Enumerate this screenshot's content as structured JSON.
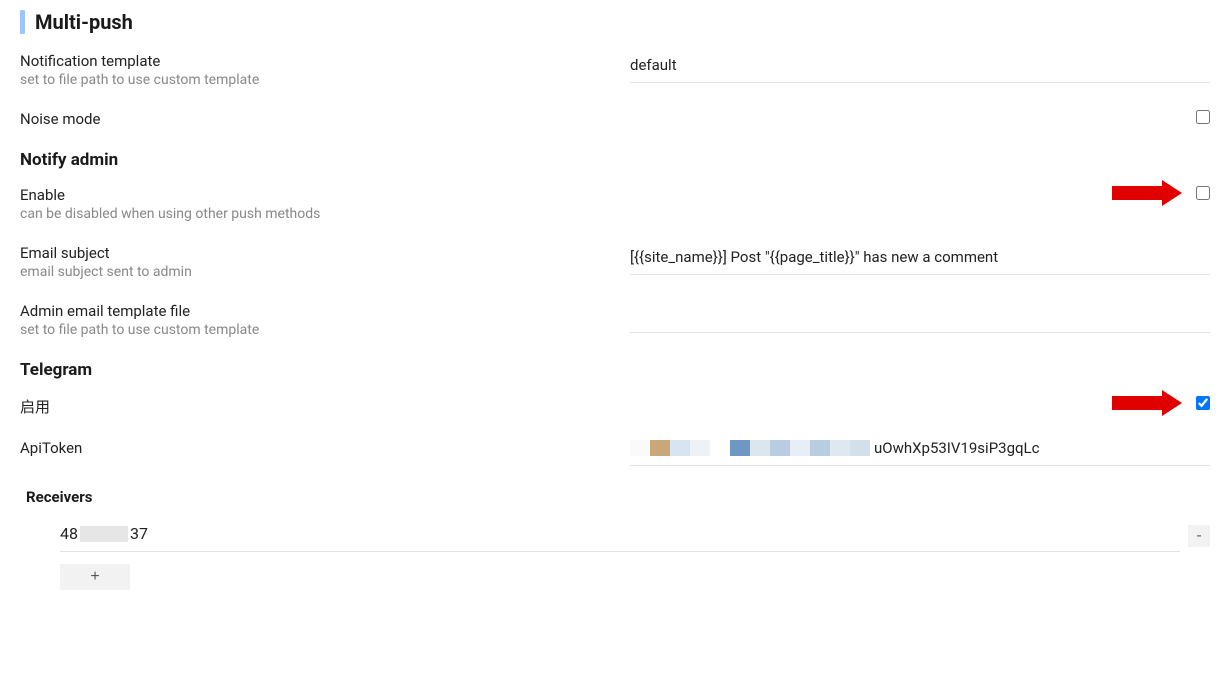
{
  "sections": {
    "multi_push": {
      "title": "Multi-push",
      "notification_template": {
        "label": "Notification template",
        "hint": "set to file path to use custom template",
        "value": "default"
      },
      "noise_mode": {
        "label": "Noise mode",
        "checked": false
      }
    },
    "notify_admin": {
      "title": "Notify admin",
      "enable": {
        "label": "Enable",
        "hint": "can be disabled when using other push methods",
        "checked": false
      },
      "email_subject": {
        "label": "Email subject",
        "hint": "email subject sent to admin",
        "value": "[{{site_name}}] Post \"{{page_title}}\" has new a comment"
      },
      "admin_email_template": {
        "label": "Admin email template file",
        "hint": "set to file path to use custom template",
        "value": ""
      }
    },
    "telegram": {
      "title": "Telegram",
      "enable": {
        "label": "启用",
        "checked": true
      },
      "api_token": {
        "label": "ApiToken",
        "visible_suffix": "uOwhXp53IV19siP3gqLc"
      },
      "receivers": {
        "title": "Receivers",
        "items": [
          {
            "prefix": "48",
            "suffix": "37"
          }
        ],
        "add_label": "+",
        "remove_label": "-"
      }
    }
  }
}
